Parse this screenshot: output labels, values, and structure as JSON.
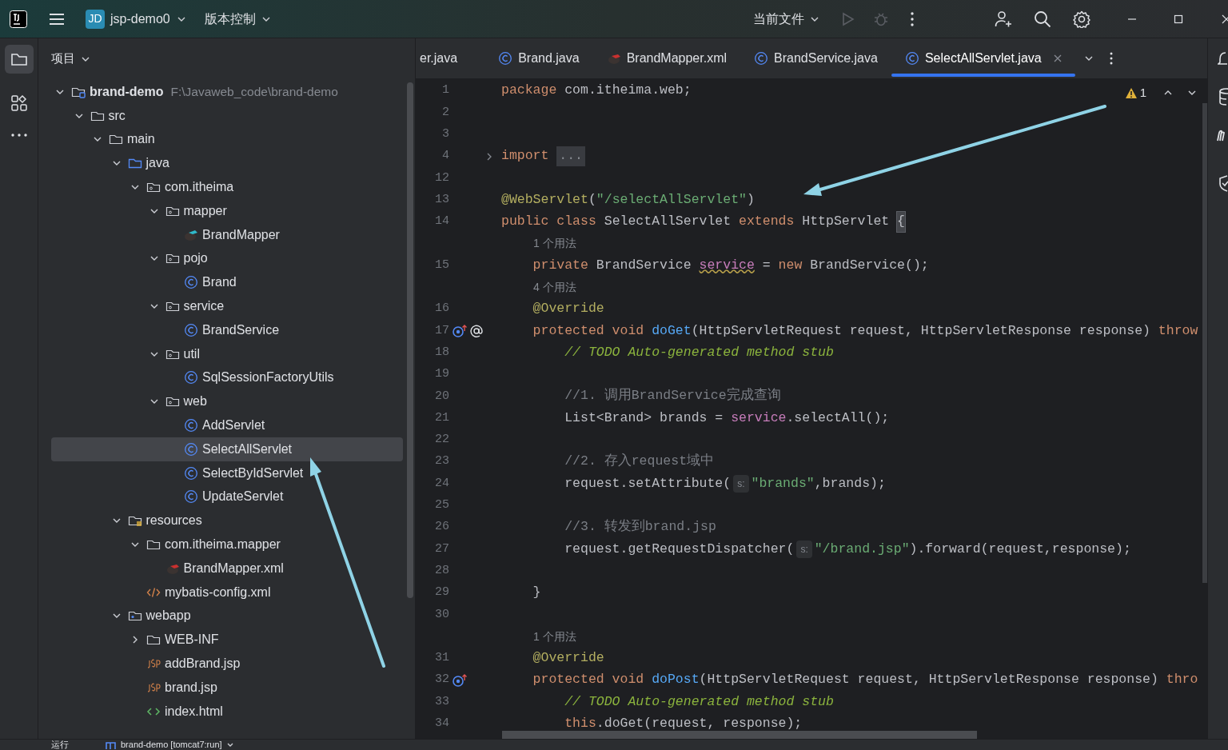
{
  "title_bar": {
    "project_badge": "JD",
    "project": "jsp-demo0",
    "vcs": "版本控制",
    "run_config": "当前文件",
    "run_enabled": false
  },
  "project_panel": {
    "title": "项目",
    "tree": [
      {
        "label": "brand-demo",
        "hint": "F:\\Javaweb_code\\brand-demo",
        "kind": "project",
        "expanded": true,
        "selected": false,
        "children": [
          {
            "label": "src",
            "kind": "folder",
            "expanded": true,
            "selected": false,
            "children": [
              {
                "label": "main",
                "kind": "folder",
                "expanded": true,
                "selected": false,
                "children": [
                  {
                    "label": "java",
                    "kind": "source",
                    "expanded": true,
                    "selected": false,
                    "children": [
                      {
                        "label": "com.itheima",
                        "kind": "package",
                        "expanded": true,
                        "selected": false,
                        "children": [
                          {
                            "label": "mapper",
                            "kind": "package",
                            "expanded": true,
                            "selected": false,
                            "children": [
                              {
                                "label": "BrandMapper",
                                "kind": "mybatis",
                                "selected": false
                              }
                            ]
                          },
                          {
                            "label": "pojo",
                            "kind": "package",
                            "expanded": true,
                            "selected": false,
                            "children": [
                              {
                                "label": "Brand",
                                "kind": "class",
                                "selected": false
                              }
                            ]
                          },
                          {
                            "label": "service",
                            "kind": "package",
                            "expanded": true,
                            "selected": false,
                            "children": [
                              {
                                "label": "BrandService",
                                "kind": "class",
                                "selected": false
                              }
                            ]
                          },
                          {
                            "label": "util",
                            "kind": "package",
                            "expanded": true,
                            "selected": false,
                            "children": [
                              {
                                "label": "SqlSessionFactoryUtils",
                                "kind": "class",
                                "selected": false
                              }
                            ]
                          },
                          {
                            "label": "web",
                            "kind": "package",
                            "expanded": true,
                            "selected": false,
                            "children": [
                              {
                                "label": "AddServlet",
                                "kind": "class",
                                "selected": false
                              },
                              {
                                "label": "SelectAllServlet",
                                "kind": "class",
                                "selected": true
                              },
                              {
                                "label": "SelectByIdServlet",
                                "kind": "class",
                                "selected": false
                              },
                              {
                                "label": "UpdateServlet",
                                "kind": "class",
                                "selected": false
                              }
                            ]
                          }
                        ]
                      }
                    ]
                  },
                  {
                    "label": "resources",
                    "kind": "resources",
                    "expanded": true,
                    "selected": false,
                    "children": [
                      {
                        "label": "com.itheima.mapper",
                        "kind": "folder",
                        "expanded": true,
                        "selected": false,
                        "children": [
                          {
                            "label": "BrandMapper.xml",
                            "kind": "mybatis_xml",
                            "selected": false
                          }
                        ]
                      },
                      {
                        "label": "mybatis-config.xml",
                        "kind": "xml",
                        "selected": false
                      }
                    ]
                  },
                  {
                    "label": "webapp",
                    "kind": "web",
                    "expanded": true,
                    "selected": false,
                    "children": [
                      {
                        "label": "WEB-INF",
                        "kind": "folder",
                        "expanded": false,
                        "selected": false
                      },
                      {
                        "label": "addBrand.jsp",
                        "kind": "jsp",
                        "selected": false
                      },
                      {
                        "label": "brand.jsp",
                        "kind": "jsp",
                        "selected": false
                      },
                      {
                        "label": "index.html",
                        "kind": "html",
                        "selected": false
                      }
                    ]
                  }
                ]
              }
            ]
          }
        ]
      }
    ]
  },
  "editor": {
    "tabs": [
      {
        "label": "er.java",
        "selected": false
      },
      {
        "label": "Brand.java",
        "kind": "class",
        "selected": false
      },
      {
        "label": "BrandMapper.xml",
        "kind": "mybatis_xml",
        "selected": false
      },
      {
        "label": "BrandService.java",
        "kind": "class",
        "selected": false
      },
      {
        "label": "SelectAllServlet.java",
        "kind": "class",
        "selected": true
      }
    ],
    "warnings": "1",
    "lines": [
      {
        "kind": "code",
        "number": "1",
        "tokens": [
          {
            "kind": "kw",
            "text": "package "
          },
          {
            "kind": "plain",
            "text": "com.itheima.web;"
          }
        ]
      },
      {
        "kind": "code",
        "number": "2"
      },
      {
        "kind": "code",
        "number": "3"
      },
      {
        "kind": "code",
        "number": "4",
        "markers": [
          {
            "kind": "fold"
          }
        ],
        "tokens": [
          {
            "kind": "kw",
            "text": "import "
          },
          {
            "kind": "fold",
            "text": "..."
          }
        ]
      },
      {
        "kind": "code",
        "number": "12"
      },
      {
        "kind": "code",
        "number": "13",
        "tokens": [
          {
            "kind": "ann",
            "text": "@WebServlet"
          },
          {
            "kind": "plain",
            "text": "("
          },
          {
            "kind": "str",
            "text": "\"/selectAllServlet\""
          },
          {
            "kind": "plain",
            "text": ")"
          }
        ]
      },
      {
        "kind": "code",
        "number": "14",
        "tokens": [
          {
            "kind": "kw",
            "text": "public class "
          },
          {
            "kind": "plain",
            "text": "SelectAllServlet "
          },
          {
            "kind": "kw",
            "text": "extends "
          },
          {
            "kind": "plain",
            "text": "HttpServlet "
          },
          {
            "kind": "brace",
            "text": "{"
          }
        ]
      },
      {
        "kind": "usage",
        "text": "1 个用法"
      },
      {
        "kind": "code",
        "number": "15",
        "tokens": [
          {
            "kind": "kw",
            "text": "    private "
          },
          {
            "kind": "plain",
            "text": "BrandService "
          },
          {
            "kind": "field_warn",
            "text": "service"
          },
          {
            "kind": "plain",
            "text": " = "
          },
          {
            "kind": "kw",
            "text": "new "
          },
          {
            "kind": "plain",
            "text": "BrandService();"
          }
        ]
      },
      {
        "kind": "usage",
        "text": "4 个用法"
      },
      {
        "kind": "code",
        "number": "16",
        "tokens": [
          {
            "kind": "ann",
            "text": "    @Override"
          }
        ]
      },
      {
        "kind": "code",
        "number": "17",
        "markers": [
          {
            "kind": "override"
          },
          {
            "kind": "mention"
          }
        ],
        "tokens": [
          {
            "kind": "kw",
            "text": "    protected void "
          },
          {
            "kind": "fn",
            "text": "doGet"
          },
          {
            "kind": "plain",
            "text": "(HttpServletRequest request, HttpServletResponse response) "
          },
          {
            "kind": "kw",
            "text": "throw"
          }
        ]
      },
      {
        "kind": "code",
        "number": "18",
        "tokens": [
          {
            "kind": "todo",
            "text": "        // TODO Auto-generated method stub"
          }
        ]
      },
      {
        "kind": "code",
        "number": "19"
      },
      {
        "kind": "code",
        "number": "20",
        "tokens": [
          {
            "kind": "comment",
            "text": "        //1. 调用BrandService完成查询"
          }
        ]
      },
      {
        "kind": "code",
        "number": "21",
        "tokens": [
          {
            "kind": "plain",
            "text": "        List<Brand> brands = "
          },
          {
            "kind": "field",
            "text": "service"
          },
          {
            "kind": "plain",
            "text": ".selectAll();"
          }
        ]
      },
      {
        "kind": "code",
        "number": "22"
      },
      {
        "kind": "code",
        "number": "23",
        "tokens": [
          {
            "kind": "comment",
            "text": "        //2. 存入request域中"
          }
        ]
      },
      {
        "kind": "code",
        "number": "24",
        "tokens": [
          {
            "kind": "plain",
            "text": "        request.setAttribute("
          },
          {
            "kind": "hint",
            "text": "s:"
          },
          {
            "kind": "str",
            "text": "\"brands\""
          },
          {
            "kind": "plain",
            "text": ",brands);"
          }
        ]
      },
      {
        "kind": "code",
        "number": "25"
      },
      {
        "kind": "code",
        "number": "26",
        "tokens": [
          {
            "kind": "comment",
            "text": "        //3. 转发到brand.jsp"
          }
        ]
      },
      {
        "kind": "code",
        "number": "27",
        "tokens": [
          {
            "kind": "plain",
            "text": "        request.getRequestDispatcher("
          },
          {
            "kind": "hint",
            "text": "s:"
          },
          {
            "kind": "str",
            "text": "\"/brand.jsp\""
          },
          {
            "kind": "plain",
            "text": ").forward(request,response);"
          }
        ]
      },
      {
        "kind": "code",
        "number": "28"
      },
      {
        "kind": "code",
        "number": "29",
        "tokens": [
          {
            "kind": "plain",
            "text": "    }"
          }
        ]
      },
      {
        "kind": "code",
        "number": "30"
      },
      {
        "kind": "usage",
        "text": "1 个用法"
      },
      {
        "kind": "code",
        "number": "31",
        "tokens": [
          {
            "kind": "ann",
            "text": "    @Override"
          }
        ]
      },
      {
        "kind": "code",
        "number": "32",
        "markers": [
          {
            "kind": "override"
          }
        ],
        "tokens": [
          {
            "kind": "kw",
            "text": "    protected void "
          },
          {
            "kind": "fn",
            "text": "doPost"
          },
          {
            "kind": "plain",
            "text": "(HttpServletRequest request, HttpServletResponse response) "
          },
          {
            "kind": "kw",
            "text": "thro"
          }
        ]
      },
      {
        "kind": "code",
        "number": "33",
        "tokens": [
          {
            "kind": "todo",
            "text": "        // TODO Auto-generated method stub"
          }
        ]
      },
      {
        "kind": "code",
        "number": "34",
        "tokens": [
          {
            "kind": "kw",
            "text": "        this"
          },
          {
            "kind": "plain",
            "text": ".doGet(request, response);"
          }
        ]
      }
    ]
  },
  "bottom_bar": {
    "tab": "运行",
    "run_config": "brand-demo [tomcat7:run]"
  }
}
